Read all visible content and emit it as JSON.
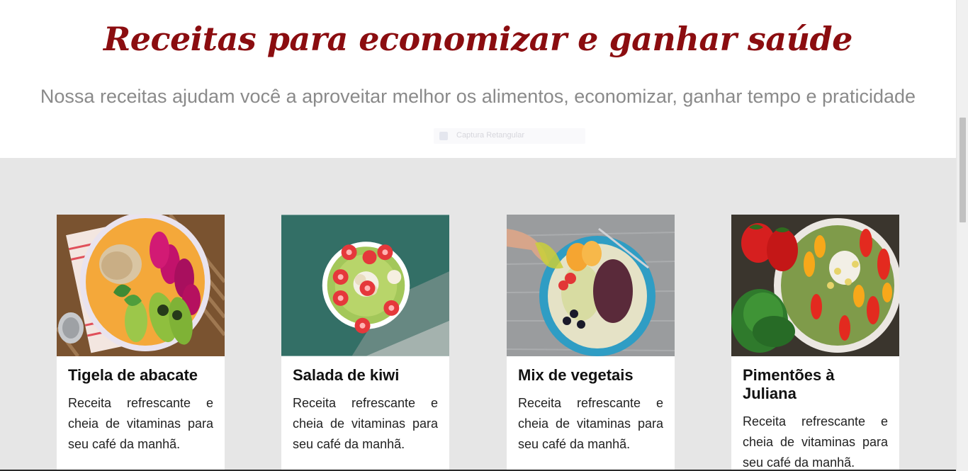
{
  "hero": {
    "title": "Receitas para economizar e ganhar saúde",
    "subtitle": "Nossa receitas ajudam você a aproveitar melhor os alimentos, economizar, ganhar tempo e praticidade"
  },
  "overlay": {
    "label": "Captura Retangular"
  },
  "cards": [
    {
      "title": "Tigela de abacate",
      "text": "Receita refrescante e cheia de vitaminas para seu café da manhã.",
      "image_icon": "avocado-bowl-photo"
    },
    {
      "title": "Salada de kiwi",
      "text": "Receita refrescante e cheia de vitaminas para seu café da manhã.",
      "image_icon": "kiwi-salad-photo"
    },
    {
      "title": "Mix de vegetais",
      "text": "Receita refrescante e cheia de vitaminas para seu café da manhã.",
      "image_icon": "vegetable-mix-photo"
    },
    {
      "title": "Pimentões à Juliana",
      "text": "Receita refrescante e cheia de vitaminas para seu café da manhã.",
      "image_icon": "peppers-salad-photo"
    }
  ],
  "colors": {
    "title": "#8b0d10",
    "section_bg": "#e6e6e6",
    "card_bg": "#ffffff"
  }
}
